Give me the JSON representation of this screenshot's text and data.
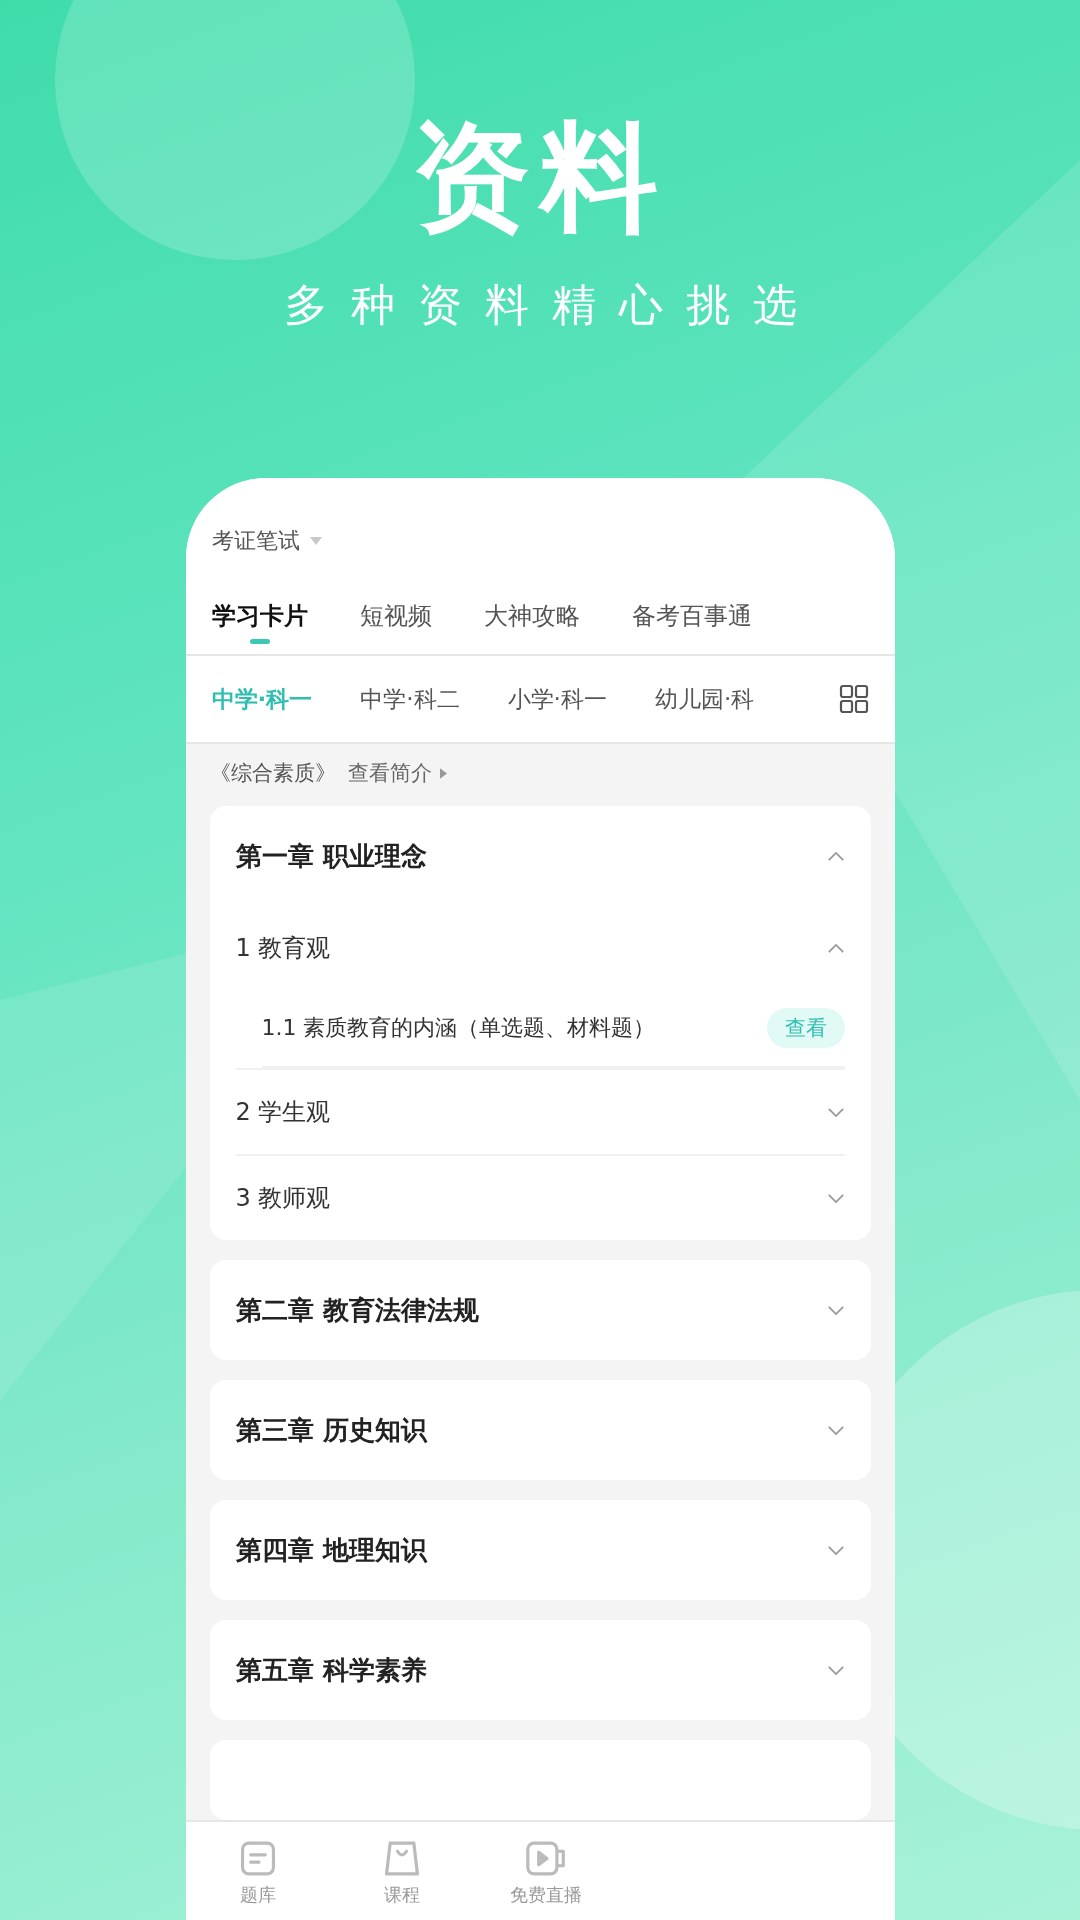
{
  "hero": {
    "title": "资料",
    "subtitle": "多种资料精心挑选"
  },
  "header": {
    "category": "考证笔试"
  },
  "tabs": [
    {
      "label": "学习卡片",
      "selected": true
    },
    {
      "label": "短视频",
      "selected": false
    },
    {
      "label": "大神攻略",
      "selected": false
    },
    {
      "label": "备考百事通",
      "selected": false
    }
  ],
  "subtabs": [
    {
      "label": "中学·科一",
      "selected": true
    },
    {
      "label": "中学·科二",
      "selected": false
    },
    {
      "label": "小学·科一",
      "selected": false
    },
    {
      "label": "幼儿园·科",
      "selected": false
    }
  ],
  "book": {
    "title": "《综合素质》",
    "link": "查看简介"
  },
  "chapters": [
    {
      "title": "第一章 职业理念",
      "expanded": true,
      "sections": [
        {
          "title": "1 教育观",
          "expanded": true,
          "items": [
            {
              "title": "1.1 素质教育的内涵（单选题、材料题）",
              "action": "查看"
            }
          ]
        },
        {
          "title": "2 学生观",
          "expanded": false
        },
        {
          "title": "3 教师观",
          "expanded": false
        }
      ]
    },
    {
      "title": "第二章 教育法律法规",
      "expanded": false
    },
    {
      "title": "第三章 历史知识",
      "expanded": false
    },
    {
      "title": "第四章 地理知识",
      "expanded": false
    },
    {
      "title": "第五章 科学素养",
      "expanded": false
    }
  ],
  "nav": [
    {
      "label": "题库",
      "kind": "list"
    },
    {
      "label": "课程",
      "kind": "bag"
    },
    {
      "label": "免费直播",
      "kind": "video"
    }
  ]
}
